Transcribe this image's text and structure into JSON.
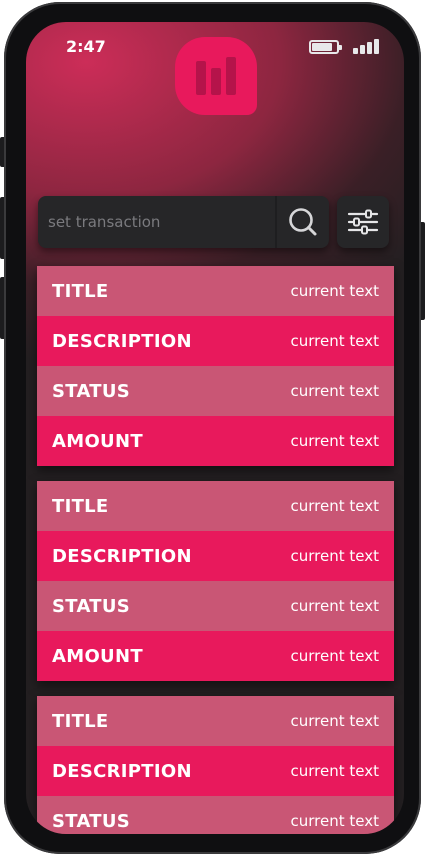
{
  "status_bar": {
    "time": "2:47"
  },
  "app": {
    "logo_icon": "bar-chart-logo-icon",
    "accent_color": "#e8195c",
    "row_alt_color": "#c95675"
  },
  "search": {
    "placeholder": "set transaction",
    "search_icon": "search-icon",
    "filter_icon": "sliders-icon"
  },
  "cards": [
    {
      "rows": [
        {
          "label": "TITLE",
          "value": "current text"
        },
        {
          "label": "DESCRIPTION",
          "value": "current text"
        },
        {
          "label": "STATUS",
          "value": "current text"
        },
        {
          "label": "AMOUNT",
          "value": "current text"
        }
      ]
    },
    {
      "rows": [
        {
          "label": "TITLE",
          "value": "current text"
        },
        {
          "label": "DESCRIPTION",
          "value": "current text"
        },
        {
          "label": "STATUS",
          "value": "current text"
        },
        {
          "label": "AMOUNT",
          "value": "current text"
        }
      ]
    },
    {
      "rows": [
        {
          "label": "TITLE",
          "value": "current text"
        },
        {
          "label": "DESCRIPTION",
          "value": "current text"
        },
        {
          "label": "STATUS",
          "value": "current text"
        }
      ]
    }
  ]
}
